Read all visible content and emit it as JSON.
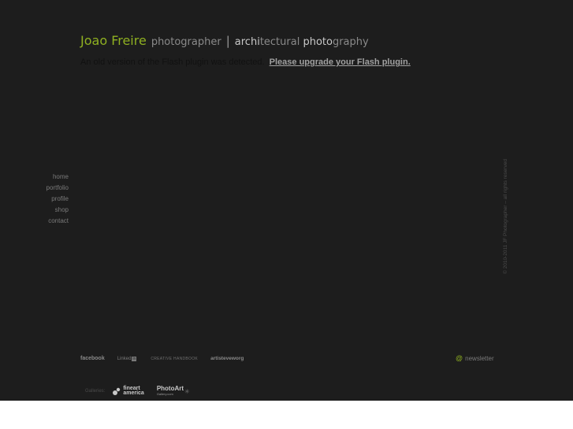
{
  "header": {
    "name": "Joao Freire",
    "role": "photographer",
    "separator": "|",
    "tagline_a": "archi",
    "tagline_b": "tectural ",
    "tagline_c": "photo",
    "tagline_d": "graphy"
  },
  "flash": {
    "message": "An old version of the Flash plugin was detected.",
    "link": "Please upgrade your Flash plugin."
  },
  "nav": {
    "items": [
      {
        "label": "home"
      },
      {
        "label": "portfolio"
      },
      {
        "label": "profile"
      },
      {
        "label": "shop"
      },
      {
        "label": "contact"
      }
    ]
  },
  "copyright": "© 2010-2011 JF Photographer – all rights reserved",
  "social": {
    "facebook": "facebook",
    "linkedin": "Linked",
    "linkedin_box": "in",
    "creative": "CREATIVE HANDBOOK",
    "artist": "artisteveworg"
  },
  "newsletter": {
    "icon": "@",
    "label": "newsletter"
  },
  "galleries": {
    "label": "Galleries:",
    "fineart_line1": "fineart",
    "fineart_line2": "america",
    "photoart_main": "PhotoArt",
    "photoart_sub": "Gallery.com"
  },
  "colors": {
    "background": "#1d1d1d",
    "accent": "#8fb021",
    "below_page": "#ffffff"
  }
}
